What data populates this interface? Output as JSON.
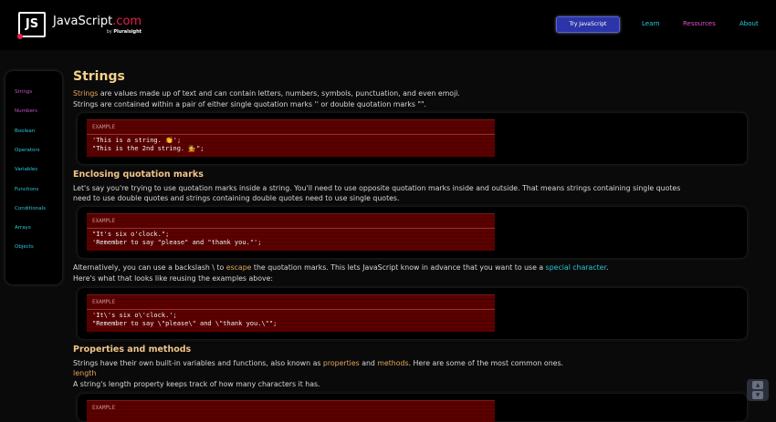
{
  "header": {
    "logo_mark": "JS",
    "logo_name": "JavaScript",
    "logo_ext": ".com",
    "logo_by": "by",
    "logo_brand": "Pluralsight",
    "try_button": "Try JavaScript",
    "nav": [
      "Learn",
      "Resources",
      "About"
    ]
  },
  "sidebar": {
    "items": [
      {
        "label": "Strings",
        "color": "#c050c0"
      },
      {
        "label": "Numbers",
        "color": "#c050c0"
      },
      {
        "label": "Boolean",
        "color": "#27c8d8"
      },
      {
        "label": "Operators",
        "color": "#27c8d8"
      },
      {
        "label": "Variables",
        "color": "#27c8d8"
      },
      {
        "label": "Functions",
        "color": "#27c8d8"
      },
      {
        "label": "Conditionals",
        "color": "#27c8d8"
      },
      {
        "label": "Arrays",
        "color": "#27c8d8"
      },
      {
        "label": "Objects",
        "color": "#27c8d8"
      }
    ]
  },
  "main": {
    "title": "Strings",
    "intro_hl": "Strings",
    "intro_rest": " are values made up of text and can contain letters, numbers, symbols, punctuation, and even emoji.",
    "intro_line2": "Strings are contained within a pair of either single quotation marks '' or double quotation marks \"\".",
    "example1": {
      "label": "EXAMPLE",
      "lines": [
        "'This is a string. 👏';",
        "\"This is the 2nd string. 💁\";"
      ]
    },
    "section2_title": "Enclosing quotation marks",
    "section2_p1": "Let's say you're trying to use quotation marks inside a string. You'll need to use opposite quotation marks inside and outside. That means strings containing single quotes",
    "section2_p2": "need to use double quotes and strings containing double quotes need to use single quotes.",
    "example2": {
      "label": "EXAMPLE",
      "lines": [
        "\"It's six o'clock.\";",
        "'Remember to say \"please\" and \"thank you.\"';"
      ]
    },
    "alt_a": "Alternatively, you can use a backslash \\ to ",
    "alt_link1": "escape",
    "alt_b": " the quotation marks. This lets JavaScript know in advance that you want to use a ",
    "alt_link2": "special character",
    "alt_c": ".",
    "alt_line2": "Here's what that looks like reusing the examples above:",
    "example3": {
      "label": "EXAMPLE",
      "lines": [
        "'It\\'s six o\\'clock.';",
        "\"Remember to say \\\"please\\\" and \\\"thank you.\\\"\";"
      ]
    },
    "section3_title": "Properties and methods",
    "props_a": "Strings have their own built-in variables and functions, also known as ",
    "props_link1": "properties",
    "props_and": " and ",
    "props_link2": "methods",
    "props_b": ". Here are some of the most common ones.",
    "length_title": "length",
    "length_desc": "A string's length property keeps track of how many characters it has.",
    "example4": {
      "label": "EXAMPLE"
    }
  }
}
